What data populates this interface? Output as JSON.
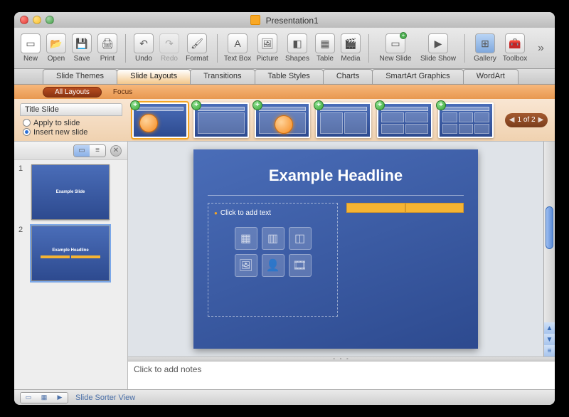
{
  "window": {
    "title": "Presentation1"
  },
  "toolbar": {
    "new": "New",
    "open": "Open",
    "save": "Save",
    "print": "Print",
    "undo": "Undo",
    "redo": "Redo",
    "format": "Format",
    "textbox": "Text Box",
    "picture": "Picture",
    "shapes": "Shapes",
    "table": "Table",
    "media": "Media",
    "newslide": "New Slide",
    "slideshow": "Slide Show",
    "gallery": "Gallery",
    "toolbox": "Toolbox"
  },
  "ribbon": {
    "tabs": [
      "Slide Themes",
      "Slide Layouts",
      "Transitions",
      "Table Styles",
      "Charts",
      "SmartArt Graphics",
      "WordArt"
    ],
    "selected": 1
  },
  "subtabs": {
    "all": "All Layouts",
    "focus": "Focus"
  },
  "layout_panel": {
    "header": "Title Slide",
    "opt_apply": "Apply to slide",
    "opt_insert": "Insert new slide",
    "selected_option": "insert",
    "pager": "1 of 2"
  },
  "slides": {
    "s1": {
      "title": "Example Slide"
    },
    "s2": {
      "title": "Example Headline"
    }
  },
  "canvas": {
    "title": "Example Headline",
    "content_prompt": "Click to add text"
  },
  "notes": {
    "placeholder": "Click to add notes"
  },
  "status": {
    "view": "Slide Sorter View"
  }
}
